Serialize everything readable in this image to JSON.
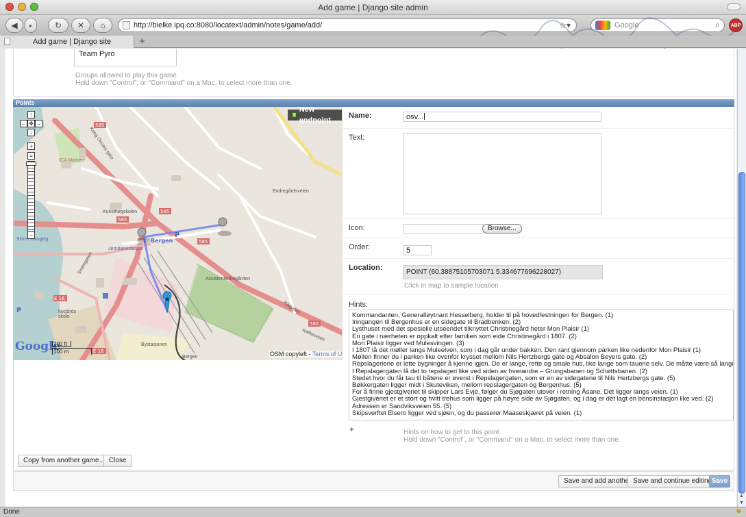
{
  "window": {
    "title": "Add game | Django site admin",
    "url": "http://bielke.ipq.co:8080/locatext/admin/notes/game/add/",
    "search_placeholder": "Google",
    "tab_title": "Add game | Django site admin",
    "adblock_label": "ABP",
    "status": "Done"
  },
  "groups": {
    "selected_option": "Team Pyro",
    "help_line1": "Groups allowed to play this game",
    "help_line2": "Hold down \"Control\", or \"Command\" on a Mac, to select more than one."
  },
  "points": {
    "header": "Points",
    "new_endpoint_label": "New endpoint",
    "name_label": "Name:",
    "name_value": "osv...",
    "text_label": "Text:",
    "icon_label": "Icon:",
    "browse_label": "Browse...",
    "order_label": "Order:",
    "order_value": "5",
    "location_label": "Location:",
    "location_value": "POINT (60.38875105703071 5.334677696228027)",
    "location_help": "Click in map to sample location",
    "hints_label": "Hints:",
    "hints": [
      "Kommandanten, Generalløytnant Hesselberg, holder til på hovedfestningen for Bergen. (1)",
      "Inngangen til Bergenhus er en sidegate til Bradbenken. (2)",
      "Lysthuset med det spesielle utseendet tilknyttet Christinegård heter Mon Plaisir (1)",
      "En gate i nærheten er oppkalt etter familien som eide Christinegård i 1807. (2)",
      "Mon Plaisir ligger ved Mulesvingen. (3)",
      "I 1807 lå det møller langs Muleelven, som i dag går under bakken. Den rant gjennom parken like nedenfor Mon Plaisir (1)",
      "Møllen finner du i parken like ovenfor krysset mellom Nils Hertzbergs gate og Absalon Beyers gate. (2)",
      "Repslageriene er lette bygninger å kjenne igjen. De er lange, rette og smale hus, like lange som tauene selv. De måtte være så lange på grunn",
      "I Repslagergaten lå det to repslageri like ved siden av hverandre – Grungsbanen og Schøttsbanen. (2)",
      "Stedet hvor du får tau til båtene er øverst i Repslagergaten, som er en av sidegatene til Nils Hertzbergs gate. (5)",
      "Bøkkergaten ligger midt i Skuteviken, mellom repslagergaten og Bergenhus. (5)",
      "For å finne gjestgiveriet til skipper Lars Evje, følger du Sjøgaten utover i retning Åsane. Det ligger langs veien. (1)",
      "Gjestgiveriet er et stort og hvitt trehus som ligger på høyre side av Sjøgaten, og i dag er det lagt en bensinstasjon like ved. (2)",
      "Adressen er Sandviksveien 55. (5)",
      "Skipsverftet Elsero ligger ved sjøen, og du passerer Maaseskjæret på veien. (1)"
    ],
    "hints_help_line1": "Hints on how to get to this point.",
    "hints_help_line2": "Hold down \"Control\", or \"Command\" on a Mac, to select more than one.",
    "copy_button": "Copy from another game...",
    "close_button": "Close"
  },
  "map": {
    "labels": {
      "ica": "ICA Marken",
      "kong_oscars": "Kong Oscars gate",
      "kunsthogskolen": "Kunsthøgskolen",
      "bergen": "Bergen",
      "assistentkirkegarden": "Assistentkirkegården",
      "nygards": "Nygårds skole",
      "bystasjonen": "Bystasjonen",
      "jernbanestasjon": "Jernbanestasjon",
      "bergen_bottom": "Bergen",
      "strommen": "Strømgaten",
      "kaigaten": "Kaigaten",
      "endregardsveien": "Endregårdsveien",
      "kalfarveien": "Kalfarveien"
    },
    "road_badges": [
      "585",
      "585",
      "585",
      "585",
      "E 16",
      "E 16",
      "585"
    ],
    "scale_ft": "200 ft",
    "scale_m": "100 m",
    "google_logo": "Google",
    "osm_copyleft": "OSM copyleft - ",
    "terms_of_use": "Terms of Use"
  },
  "actions": {
    "save_add_another": "Save and add another",
    "save_continue": "Save and continue editing",
    "save": "Save"
  },
  "colors": {
    "header_blue": "#5b82ad",
    "route_blue": "#6f7ff0",
    "road_red": "#e58e8e",
    "marker_blue": "#2a9bd6"
  }
}
